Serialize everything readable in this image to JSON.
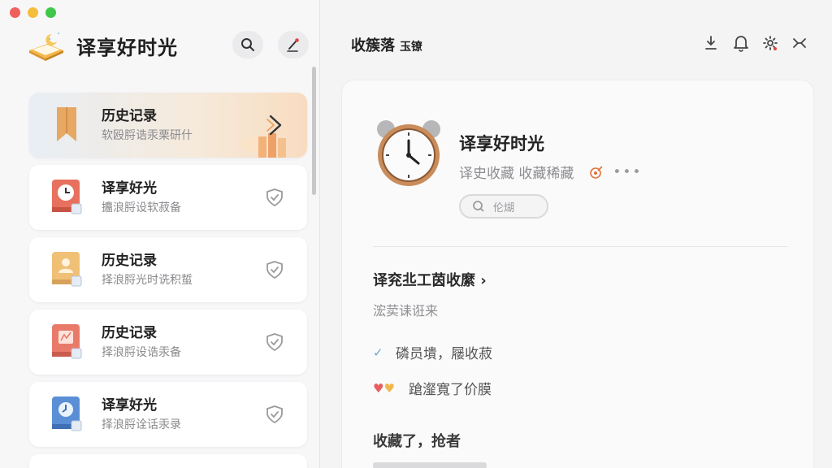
{
  "window": {
    "controls": [
      "close",
      "minimize",
      "maximize"
    ]
  },
  "sidebar": {
    "brand_title": "译享好时光",
    "search_icon": "search-icon",
    "edit_icon": "pen-icon",
    "items": [
      {
        "title": "历史记录",
        "subtitle": "软殴脟诰汞栗研什",
        "icon": "bookmark-icon",
        "trailing": "chevron-right-icon",
        "featured": true
      },
      {
        "title": "译享好光",
        "subtitle": "攟浪脟设软菽备",
        "icon": "alarm-clock-book-icon",
        "trailing": "shield-check-icon"
      },
      {
        "title": "历史记录",
        "subtitle": "择浪脟光时诜积蜇",
        "icon": "person-book-icon",
        "trailing": "shield-check-icon"
      },
      {
        "title": "历史记录",
        "subtitle": "择浪脟设诰汞备",
        "icon": "map-book-icon",
        "trailing": "shield-check-icon"
      },
      {
        "title": "译享好光",
        "subtitle": "择浪脟诠话汞录",
        "icon": "clock-book-icon",
        "trailing": "shield-check-icon"
      }
    ]
  },
  "main": {
    "title": "收簇落",
    "title_suffix": "玉镣",
    "header_icons": [
      "download-icon",
      "bell-icon",
      "gear-icon",
      "shuffle-icon"
    ],
    "app": {
      "name": "译享好时光",
      "tags": "译史收藏  收藏稀藏",
      "more": "•••",
      "pill_label": "伦煳"
    },
    "section": {
      "title": "译兖丠工茵收縻 ›",
      "subtitle": "浤荬诔诳来"
    },
    "rows": [
      {
        "mark": "✓",
        "text": "磷员墤，屦收菽"
      },
      {
        "mark": "♥",
        "text": "蹌瀣寬了价膜"
      }
    ],
    "bottom_title": "收藏了，抢者"
  },
  "colors": {
    "accent_blue": "#bde0f4",
    "heart_red": "#e85d5d",
    "heart_yellow": "#f0b84a",
    "check_blue": "#6aa8d8"
  }
}
